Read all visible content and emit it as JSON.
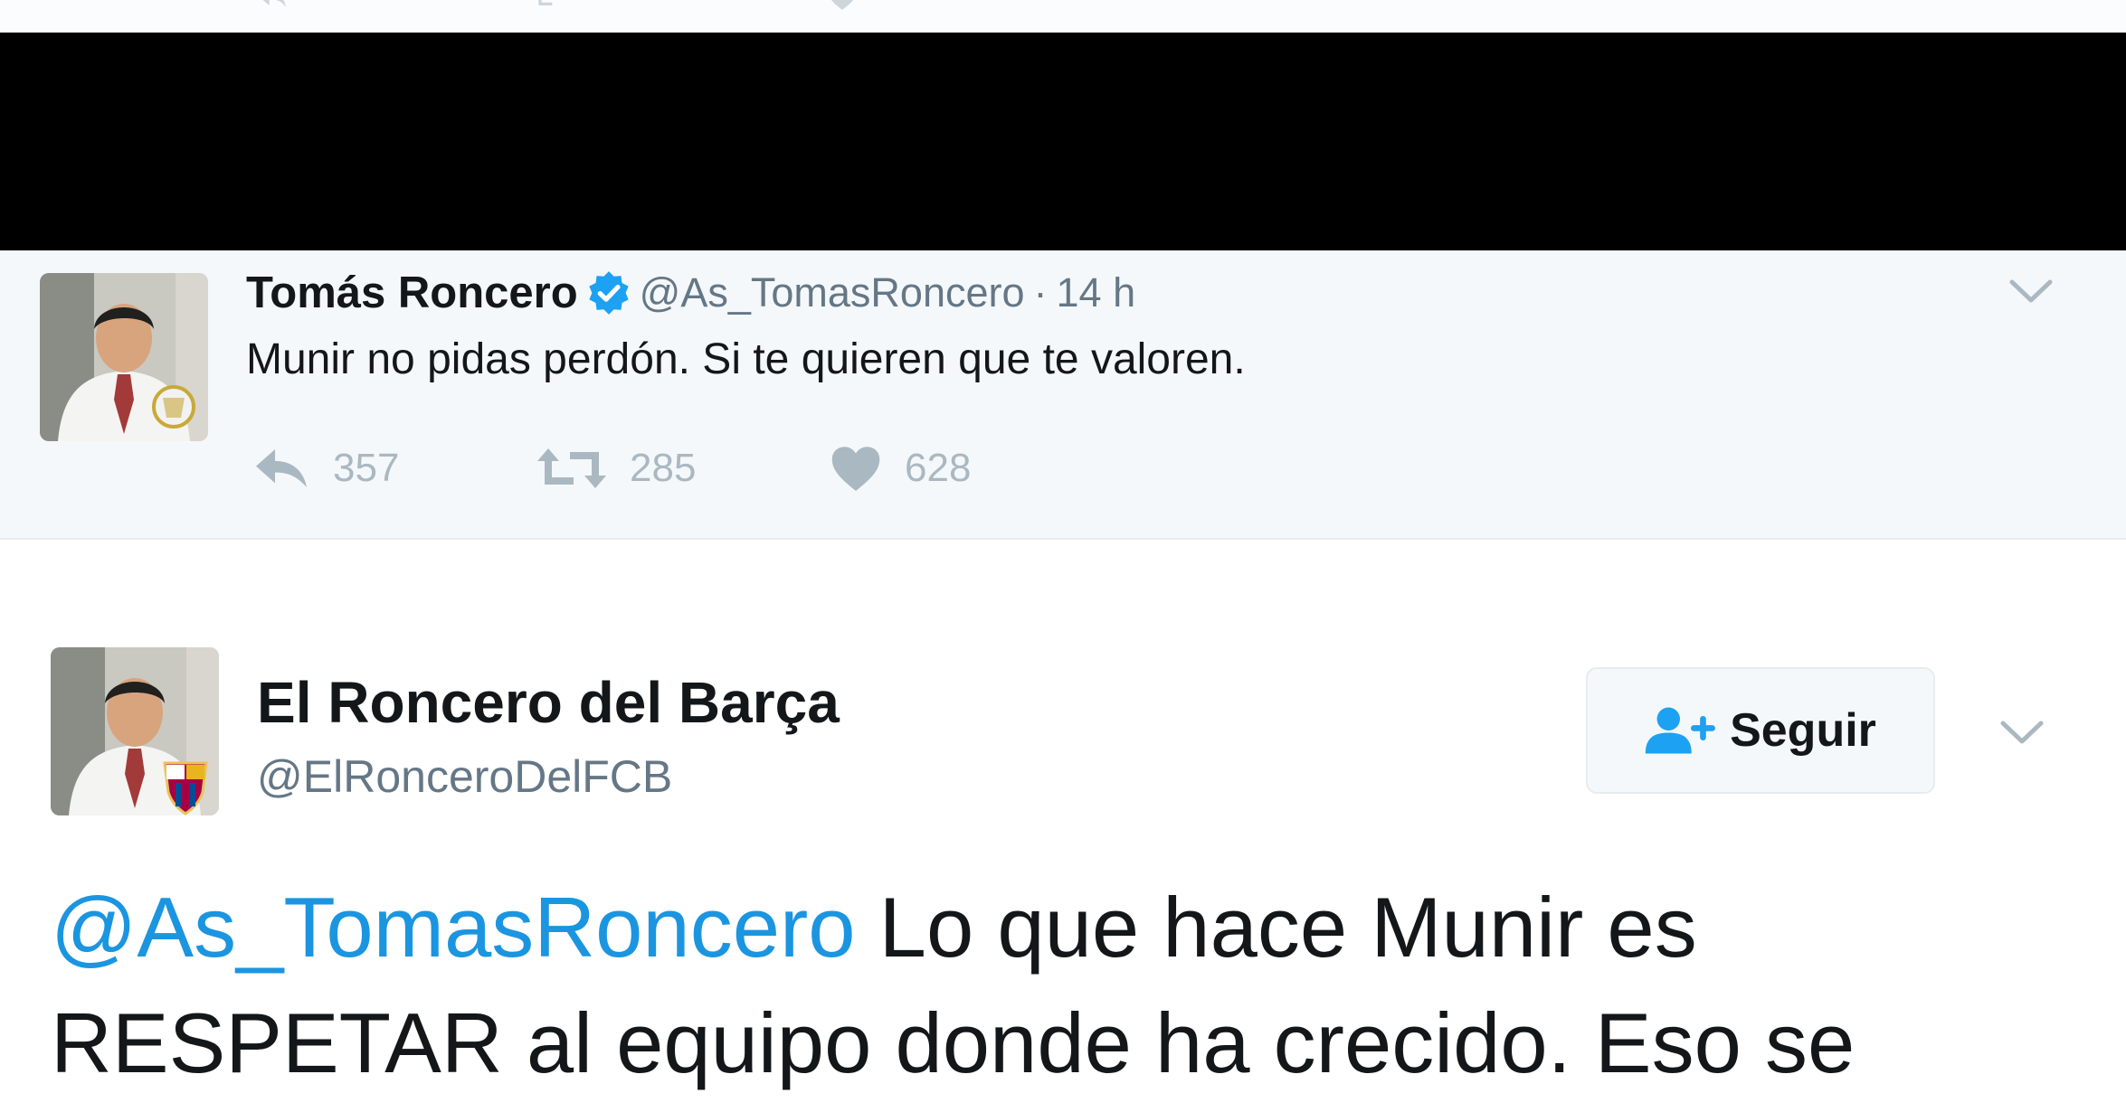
{
  "quoted_tweet": {
    "display_name": "Tomás Roncero",
    "handle": "@As_TomasRoncero",
    "separator": "·",
    "time": "14 h",
    "text": "Munir no pidas perdón. Si te quieren que te valoren.",
    "reply_count": "357",
    "retweet_count": "285",
    "like_count": "628"
  },
  "main_tweet": {
    "display_name": "El Roncero del Barça",
    "handle": "@ElRonceroDelFCB",
    "follow_label": "Seguir",
    "mention": "@As_TomasRoncero",
    "text": " Lo que hace Munir es RESPETAR al equipo donde ha crecido. Eso se"
  },
  "colors": {
    "verified_badge": "#1da1f2",
    "mention_link": "#1b95e0",
    "follow_icon": "#1da1f2",
    "action_icons": "#aab8c2",
    "quoted_background": "#f5f8fa"
  },
  "icons": [
    "reply-icon",
    "retweet-icon",
    "like-icon",
    "verified-badge-icon",
    "follow-user-icon",
    "chevron-down-icon"
  ]
}
